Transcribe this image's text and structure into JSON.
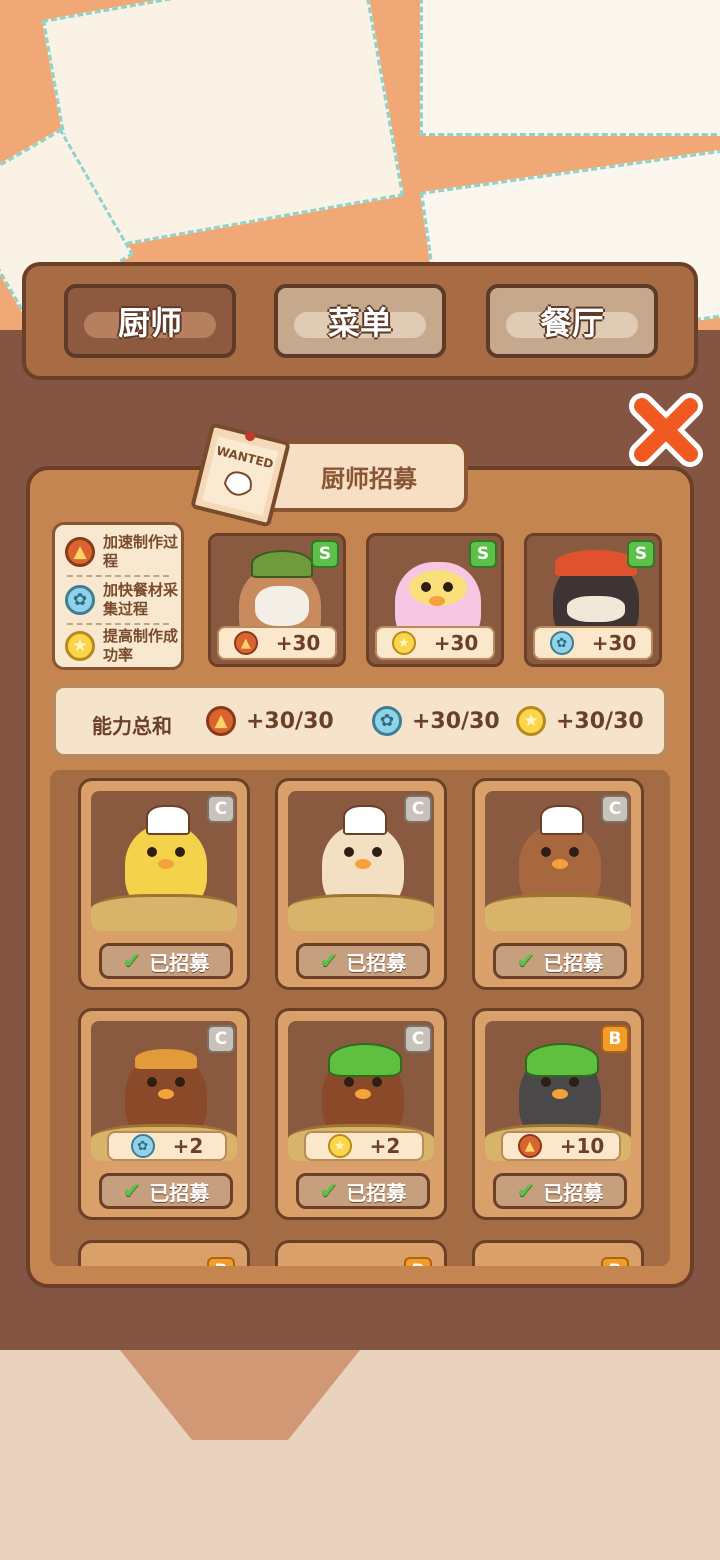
{
  "tabs": [
    {
      "label": "厨师",
      "active": true
    },
    {
      "label": "菜单",
      "active": false
    },
    {
      "label": "餐厅",
      "active": false
    }
  ],
  "panel": {
    "title": "厨师招募",
    "wanted_sign": "WANTED"
  },
  "legend": [
    {
      "icon": "fire-icon",
      "label": "加速制作过程"
    },
    {
      "icon": "fan-icon",
      "label": "加快餐材采集过程"
    },
    {
      "icon": "star-icon",
      "label": "提高制作成功率"
    }
  ],
  "featured_chefs": [
    {
      "rank": "S",
      "bonus_icon": "fire-icon",
      "bonus": "+30"
    },
    {
      "rank": "S",
      "bonus_icon": "star-icon",
      "bonus": "+30"
    },
    {
      "rank": "S",
      "bonus_icon": "fan-icon",
      "bonus": "+30"
    }
  ],
  "ability_total": {
    "label": "能力总和",
    "fire": "+30/30",
    "fan": "+30/30",
    "star": "+30/30"
  },
  "chef_cards": [
    {
      "rank": "C",
      "status": "已招募",
      "color": "#f4d24a"
    },
    {
      "rank": "C",
      "status": "已招募",
      "color": "#f3dfc2"
    },
    {
      "rank": "C",
      "status": "已招募",
      "color": "#a8683f"
    },
    {
      "rank": "C",
      "status": "已招募",
      "bonus_icon": "fan-icon",
      "bonus": "+2",
      "color": "#8a4a2a"
    },
    {
      "rank": "C",
      "status": "已招募",
      "bonus_icon": "star-icon",
      "bonus": "+2",
      "color": "#8a4a2a"
    },
    {
      "rank": "B",
      "status": "已招募",
      "bonus_icon": "fire-icon",
      "bonus": "+10",
      "color": "#4a4848"
    }
  ],
  "partial_row_ranks": [
    "B",
    "B",
    "B"
  ],
  "colors": {
    "accent": "#6b3f28",
    "panel": "#c48551",
    "close": "#f05a22"
  }
}
